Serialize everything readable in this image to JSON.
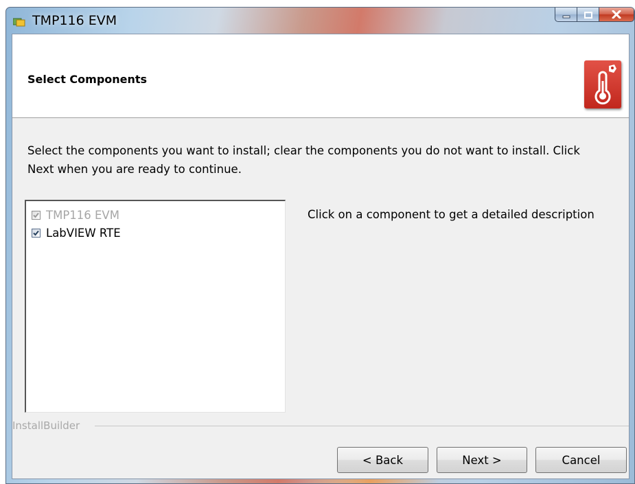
{
  "window": {
    "title": "TMP116 EVM",
    "icon": "installer-app-icon",
    "controls": [
      "minimize-icon",
      "maximize-icon",
      "close-icon"
    ]
  },
  "header": {
    "title": "Select Components",
    "logo_icon": "thermometer-logo-icon"
  },
  "description": "Select the components you want to install; clear the components you do not want to install. Click Next when you are ready to continue.",
  "components": [
    {
      "label": "TMP116 EVM",
      "checked": true,
      "enabled": false
    },
    {
      "label": "LabVIEW RTE",
      "checked": true,
      "enabled": true
    }
  ],
  "detail_text": "Click on a component to get a detailed description",
  "branding": "InstallBuilder",
  "buttons": {
    "back": "< Back",
    "next": "Next >",
    "cancel": "Cancel"
  },
  "colors": {
    "logo_red": "#c1271d",
    "disabled_text": "#a6a6a6",
    "client_background": "#f0f0f0"
  }
}
